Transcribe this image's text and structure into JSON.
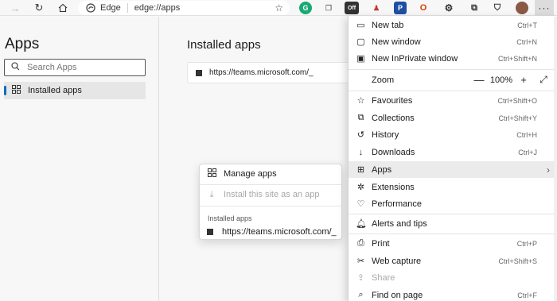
{
  "toolbar": {
    "address_site": "Edge",
    "address_url": "edge://apps",
    "ext_icons": [
      "grammarly-icon",
      "copy-icon",
      "extension-off-icon",
      "person-icon",
      "pocket-icon",
      "office-icon",
      "puzzle-icon",
      "collections-icon",
      "shield-icon",
      "profile-avatar"
    ],
    "ext_badge": "Off",
    "more_label": "···"
  },
  "sidebar": {
    "title": "Apps",
    "search_placeholder": "Search Apps",
    "nav_item": "Installed apps"
  },
  "main": {
    "title": "Installed apps",
    "app_url": "https://teams.microsoft.com/_"
  },
  "popup": {
    "items": [
      {
        "label": "Manage apps",
        "icon": "apps-grid-icon"
      },
      {
        "label": "Install this site as an app",
        "icon": "download-icon"
      }
    ],
    "section_label": "Installed apps",
    "installed_url": "https://teams.microsoft.com/_"
  },
  "menu": {
    "items": [
      {
        "label": "New tab",
        "shortcut": "Ctrl+T",
        "icon": "new-tab-icon"
      },
      {
        "label": "New window",
        "shortcut": "Ctrl+N",
        "icon": "new-window-icon"
      },
      {
        "label": "New InPrivate window",
        "shortcut": "Ctrl+Shift+N",
        "icon": "inprivate-icon"
      },
      {
        "label": "Zoom",
        "icon": "zoom"
      },
      {
        "label": "Favourites",
        "shortcut": "Ctrl+Shift+O",
        "icon": "favourites-icon"
      },
      {
        "label": "Collections",
        "shortcut": "Ctrl+Shift+Y",
        "icon": "collections-icon"
      },
      {
        "label": "History",
        "shortcut": "Ctrl+H",
        "icon": "history-icon"
      },
      {
        "label": "Downloads",
        "shortcut": "Ctrl+J",
        "icon": "downloads-icon"
      },
      {
        "label": "Apps",
        "shortcut": "",
        "icon": "apps-icon"
      },
      {
        "label": "Extensions",
        "shortcut": "",
        "icon": "extensions-icon"
      },
      {
        "label": "Performance",
        "shortcut": "",
        "icon": "performance-icon"
      },
      {
        "label": "Alerts and tips",
        "shortcut": "",
        "icon": "alerts-icon"
      },
      {
        "label": "Print",
        "shortcut": "Ctrl+P",
        "icon": "print-icon"
      },
      {
        "label": "Web capture",
        "shortcut": "Ctrl+Shift+S",
        "icon": "web-capture-icon"
      },
      {
        "label": "Share",
        "shortcut": "",
        "icon": "share-icon"
      },
      {
        "label": "Find on page",
        "shortcut": "Ctrl+F",
        "icon": "find-icon"
      }
    ],
    "zoom": {
      "minus": "—",
      "value": "100%",
      "plus": "+"
    }
  },
  "colors": {
    "accent": "#0f6cbd",
    "menu_active_bg": "#ebebeb"
  }
}
